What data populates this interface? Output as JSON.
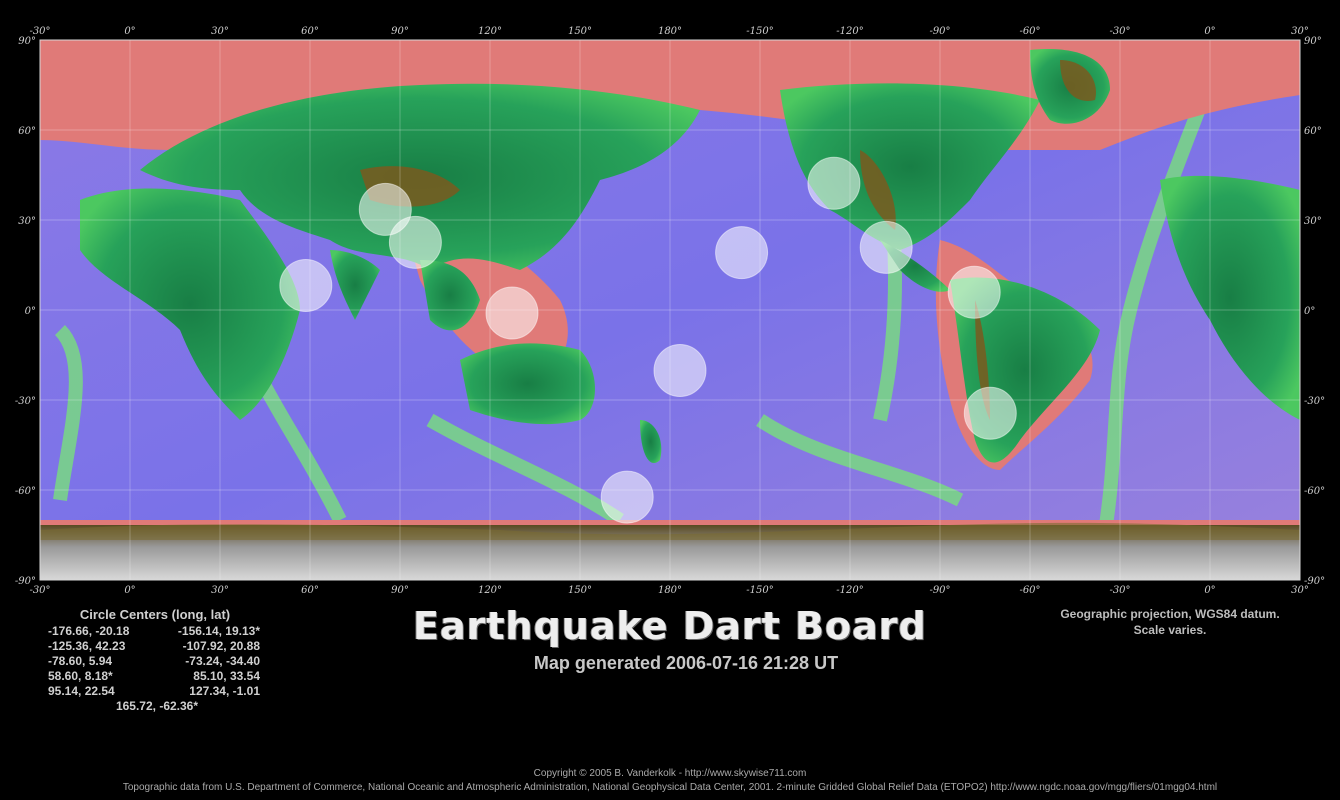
{
  "map": {
    "lon_labels": [
      "-30°",
      "0°",
      "30°",
      "60°",
      "90°",
      "120°",
      "150°",
      "180°",
      "-150°",
      "-120°",
      "-90°",
      "-60°",
      "-30°",
      "0°",
      "30°"
    ],
    "lat_labels": [
      "90°",
      "60°",
      "30°",
      "0°",
      "-30°",
      "-60°",
      "-90°"
    ],
    "circles": [
      {
        "lon": -176.66,
        "lat": -20.18
      },
      {
        "lon": -156.14,
        "lat": 19.13
      },
      {
        "lon": -125.36,
        "lat": 42.23
      },
      {
        "lon": -107.92,
        "lat": 20.88
      },
      {
        "lon": -78.6,
        "lat": 5.94
      },
      {
        "lon": -73.24,
        "lat": -34.4
      },
      {
        "lon": 58.6,
        "lat": 8.18
      },
      {
        "lon": 85.1,
        "lat": 33.54
      },
      {
        "lon": 95.14,
        "lat": 22.54
      },
      {
        "lon": 127.34,
        "lat": -1.01
      },
      {
        "lon": 165.72,
        "lat": -62.36
      }
    ],
    "colors": {
      "ocean_deep": "#6e6ee6",
      "ocean_mid": "#9a7ae0",
      "shelf": "#e07a78",
      "ridge": "#7ee07a",
      "lowland": "#1f9a55",
      "highland": "#7a5a1e",
      "ice": "#bdbdbd",
      "circle": "#ffffff"
    }
  },
  "title": "Earthquake Dart Board",
  "subtitle": "Map generated 2006-07-16 21:28 UT",
  "centers": {
    "heading": "Circle Centers (long, lat)",
    "rows": [
      [
        "-176.66,  -20.18",
        "-156.14,  19.13*"
      ],
      [
        "-125.36,  42.23",
        "-107.92,  20.88"
      ],
      [
        "-78.60,   5.94",
        "-73.24,  -34.40"
      ],
      [
        "58.60,   8.18*",
        "85.10,  33.54"
      ],
      [
        "95.14,  22.54",
        "127.34,   -1.01"
      ]
    ],
    "last": "165.72,  -62.36*"
  },
  "projection": [
    "Geographic projection, WGS84 datum.",
    "Scale varies."
  ],
  "copyright": "Copyright © 2005 B. Vanderkolk - http://www.skywise711.com",
  "source": "Topographic data from U.S. Department of Commerce, National Oceanic and Atmospheric Administration, National Geophysical Data Center, 2001. 2-minute Gridded Global Relief Data (ETOPO2) http://www.ngdc.noaa.gov/mgg/fliers/01mgg04.html"
}
